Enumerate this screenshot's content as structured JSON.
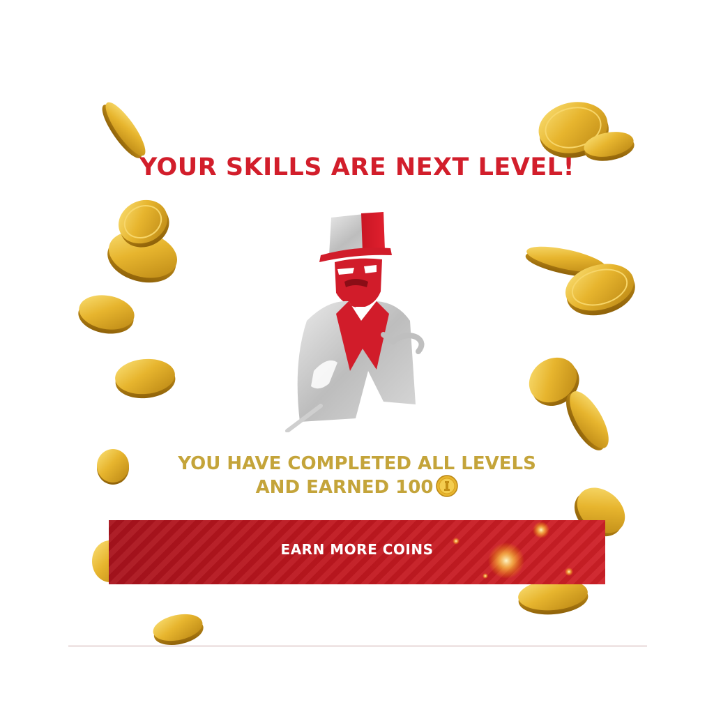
{
  "headline": "YOUR SKILLS ARE NEXT LEVEL!",
  "message": {
    "line1": "YOU HAVE COMPLETED ALL LEVELS",
    "line2": "AND EARNED 100"
  },
  "reward_icon": "coin-icon",
  "button": {
    "label": "EARN MORE COINS"
  },
  "mascot_icon": "top-hat-gentleman-icon",
  "colors": {
    "headline": "#d21e2b",
    "message": "#c4a43a",
    "button": "#c0171f",
    "coin": "#e8b830"
  }
}
